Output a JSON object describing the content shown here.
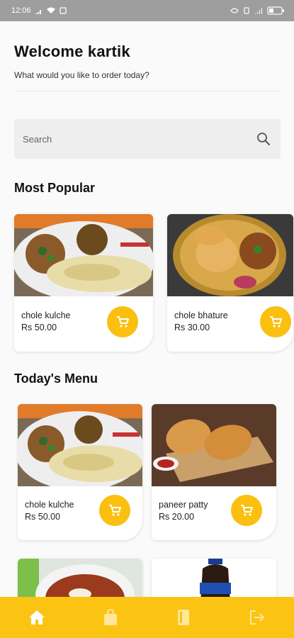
{
  "status_bar": {
    "time": "12:06"
  },
  "header": {
    "greeting": "Welcome kartik",
    "subtitle": "What would you like to order today?"
  },
  "search": {
    "placeholder": "Search"
  },
  "sections": {
    "most_popular": "Most Popular",
    "todays_menu": "Today's Menu"
  },
  "most_popular": [
    {
      "name": "chole kulche",
      "price": "Rs 50.00"
    },
    {
      "name": "chole bhature",
      "price": "Rs 30.00"
    }
  ],
  "todays_menu": [
    {
      "name": "chole kulche",
      "price": "Rs 50.00"
    },
    {
      "name": "paneer patty",
      "price": "Rs 20.00"
    }
  ],
  "bottom_nav": {
    "items": [
      "home-icon",
      "shopping-bag-icon",
      "book-icon",
      "logout-icon"
    ],
    "active": "home-icon"
  },
  "colors": {
    "accent": "#fbc413",
    "cart_button": "#fbbf0f",
    "status_bar": "#9e9e9e"
  }
}
